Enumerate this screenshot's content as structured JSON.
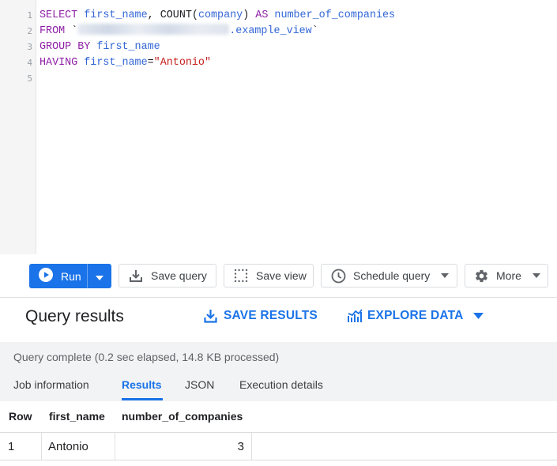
{
  "editor": {
    "line_numbers": [
      "1",
      "2",
      "3",
      "4",
      "5"
    ],
    "lines": [
      {
        "select_kw": "SELECT",
        "col1": "first_name",
        "comma": ",",
        "count_fn": "COUNT(",
        "col2": "company",
        "close": ")",
        "as_kw": "AS",
        "alias": "number_of_companies"
      },
      {
        "from_kw": "FROM",
        "tick_open": "`",
        "view": ".example_view",
        "tick_close": "`"
      },
      {
        "group_kw": "GROUP BY",
        "col": "first_name"
      },
      {
        "having_kw": "HAVING",
        "col": "first_name",
        "eq": "=",
        "value": "\"Antonio\""
      }
    ]
  },
  "toolbar": {
    "run_label": "Run",
    "save_query_label": "Save query",
    "save_view_label": "Save view",
    "schedule_label": "Schedule query",
    "more_label": "More"
  },
  "results": {
    "title": "Query results",
    "save_results": "SAVE RESULTS",
    "explore_data": "EXPLORE DATA",
    "status": "Query complete (0.2 sec elapsed, 14.8 KB processed)",
    "tabs": [
      "Job information",
      "Results",
      "JSON",
      "Execution details"
    ],
    "columns": [
      "Row",
      "first_name",
      "number_of_companies"
    ],
    "rows": [
      {
        "row": "1",
        "first_name": "Antonio",
        "number_of_companies": "3"
      }
    ]
  },
  "colors": {
    "accent": "#1a73e8",
    "keyword": "#8f1fa6",
    "identifier": "#3367d6",
    "string": "#c5221f"
  }
}
